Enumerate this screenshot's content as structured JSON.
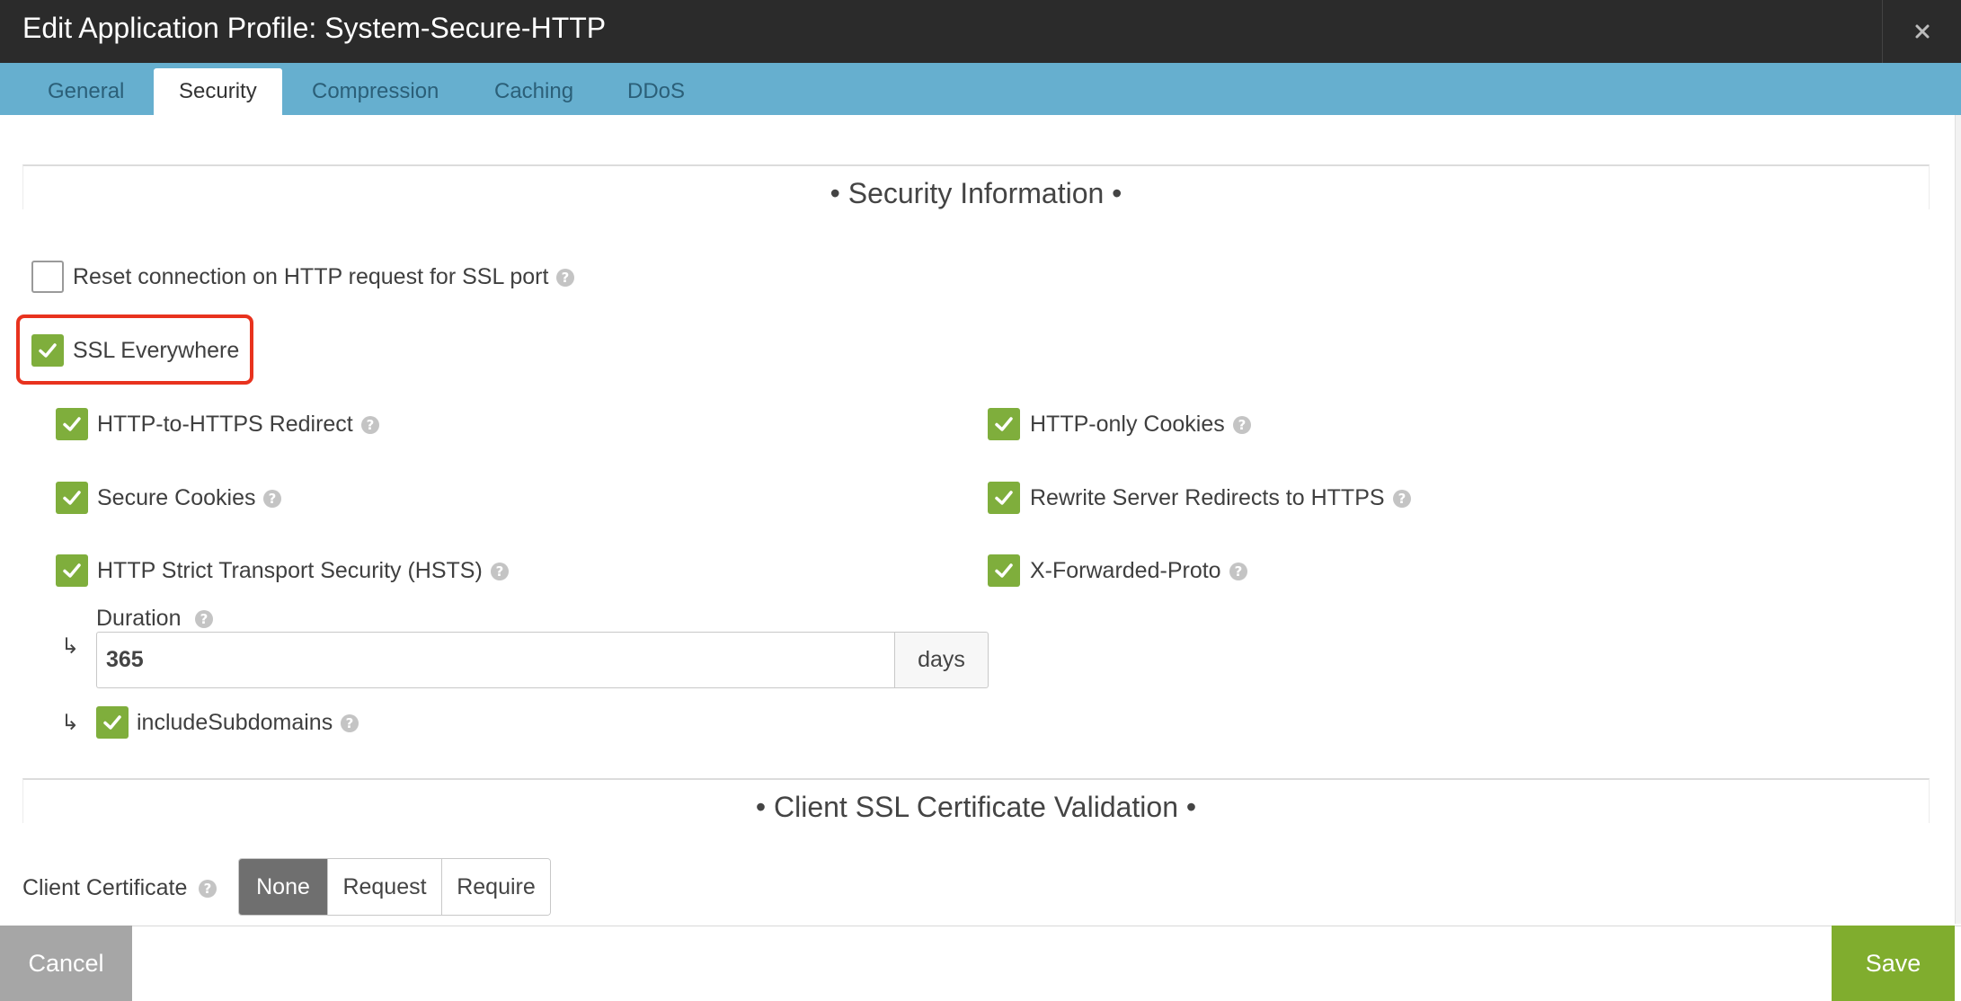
{
  "window": {
    "title": "Edit Application Profile: System-Secure-HTTP"
  },
  "tabs": [
    {
      "label": "General",
      "active": false
    },
    {
      "label": "Security",
      "active": true
    },
    {
      "label": "Compression",
      "active": false
    },
    {
      "label": "Caching",
      "active": false
    },
    {
      "label": "DDoS",
      "active": false
    }
  ],
  "security_section": {
    "title": "• Security Information •",
    "reset_connection": {
      "label": "Reset connection on HTTP request for SSL port",
      "checked": false
    },
    "ssl_everywhere": {
      "label": "SSL Everywhere",
      "checked": true
    },
    "http_to_https_redirect": {
      "label": "HTTP-to-HTTPS Redirect",
      "checked": true
    },
    "http_only_cookies": {
      "label": "HTTP-only Cookies",
      "checked": true
    },
    "secure_cookies": {
      "label": "Secure Cookies",
      "checked": true
    },
    "rewrite_server_redirects": {
      "label": "Rewrite Server Redirects to HTTPS",
      "checked": true
    },
    "hsts": {
      "label": "HTTP Strict Transport Security (HSTS)",
      "checked": true
    },
    "x_forwarded_proto": {
      "label": "X-Forwarded-Proto",
      "checked": true
    },
    "duration": {
      "label": "Duration",
      "value": "365",
      "unit": "days"
    },
    "include_subdomains": {
      "label": "includeSubdomains",
      "checked": true
    },
    "sub_arrow": "↳"
  },
  "client_ssl_section": {
    "title": "• Client SSL Certificate Validation •",
    "client_certificate": {
      "label": "Client Certificate",
      "options": [
        "None",
        "Request",
        "Require"
      ],
      "selected": "None"
    }
  },
  "footer": {
    "cancel_label": "Cancel",
    "save_label": "Save"
  },
  "colors": {
    "title_bar": "#2b2b2b",
    "tab_bar": "#66afcf",
    "checkbox_checked": "#7fae3c",
    "save_button": "#80ad2e",
    "cancel_button": "#a6a6a6",
    "highlight_outline": "#e8321e",
    "segment_selected": "#6f6f6f"
  },
  "icons": {
    "close": "close-icon",
    "help": "help-icon",
    "check": "checkmark-icon"
  }
}
